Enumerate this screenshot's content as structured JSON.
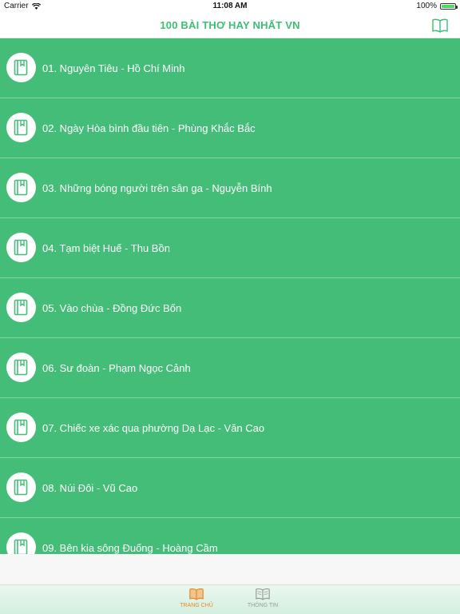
{
  "status_bar": {
    "carrier": "Carrier",
    "time": "11:08 AM",
    "battery_text": "100%",
    "battery_level": 1.0
  },
  "nav": {
    "title": "100 BÀI THƠ HAY NHẤT VN",
    "right_icon": "book-open-icon"
  },
  "colors": {
    "accent": "#3ebe74",
    "list_background": "#44bd78",
    "tab_active": "#e08a2c",
    "tab_inactive": "#9a9a9a"
  },
  "poems": [
    {
      "label": "01. Nguyên Tiêu - Hồ Chí Minh"
    },
    {
      "label": "02. Ngày Hòa bình đầu tiên - Phùng Khắc Bắc"
    },
    {
      "label": "03. Những bóng người trên sân ga - Nguyễn Bính"
    },
    {
      "label": "04. Tạm biệt Huế - Thu Bồn"
    },
    {
      "label": "05. Vào chùa - Đồng Đức Bốn"
    },
    {
      "label": "06. Sư đoàn - Phạm Ngọc Cảnh"
    },
    {
      "label": "07. Chiếc xe xác qua phường Dạ Lạc - Văn Cao"
    },
    {
      "label": "08. Núi Đôi - Vũ Cao"
    },
    {
      "label": "09. Bên kia sông Đuống - Hoàng Cầm"
    }
  ],
  "tabs": [
    {
      "label": "TRANG CHỦ",
      "icon": "book-open-icon",
      "active": true
    },
    {
      "label": "THÔNG TIN",
      "icon": "book-open-icon",
      "active": false
    }
  ]
}
